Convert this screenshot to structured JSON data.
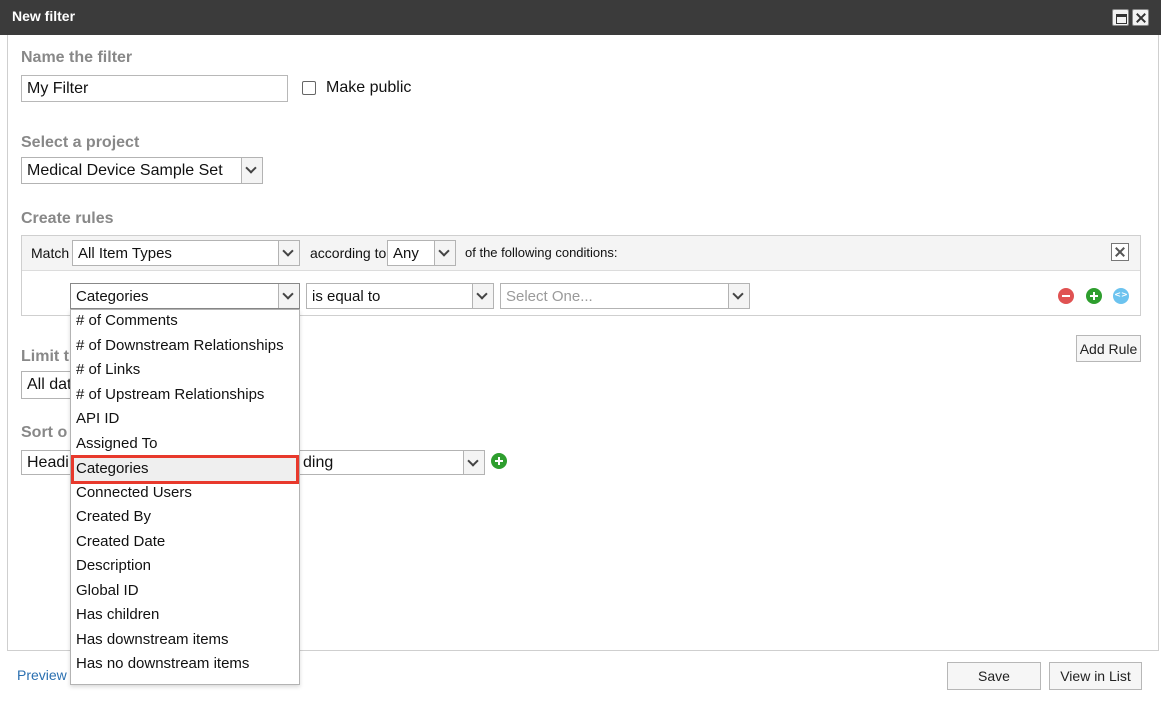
{
  "window": {
    "title": "New filter",
    "maximize_icon": "maximize-icon",
    "close_icon": "close-icon"
  },
  "name_section": {
    "label": "Name the filter",
    "filter_name_value": "My Filter",
    "make_public_label": "Make public",
    "make_public_checked": false
  },
  "project_section": {
    "label": "Select a project",
    "selected_project": "Medical Device Sample Set"
  },
  "rules_section": {
    "label": "Create rules",
    "match_label": "Match",
    "item_type_value": "All Item Types",
    "according_to_label": "according to",
    "any_value": "Any",
    "conditions_label": "of the following conditions:",
    "rule": {
      "field_value": "Categories",
      "operator_value": "is equal to",
      "value_placeholder": "Select One..."
    },
    "add_rule_label": "Add Rule"
  },
  "limit_section": {
    "label_partial": "Limit t",
    "select_partial": "All dat"
  },
  "sort_section": {
    "label_partial": "Sort o",
    "field_partial": "Headi",
    "direction_partial": "ding"
  },
  "dropdown": {
    "options": [
      "# of Comments",
      "# of Downstream Relationships",
      "# of Links",
      "# of Upstream Relationships",
      "API ID",
      "Assigned To",
      "Categories",
      "Connected Users",
      "Created By",
      "Created Date",
      "Description",
      "Global ID",
      "Has children",
      "Has downstream items",
      "Has no downstream items"
    ],
    "selected": "Categories"
  },
  "footer": {
    "preview_label": "Preview",
    "save_label": "Save",
    "view_in_list_label": "View in List"
  },
  "colors": {
    "titlebar": "#3b3b3b",
    "highlight_border": "#e8392c",
    "link": "#2a6fb0",
    "add_green": "#2e9e2e",
    "remove_red": "#e05252"
  }
}
